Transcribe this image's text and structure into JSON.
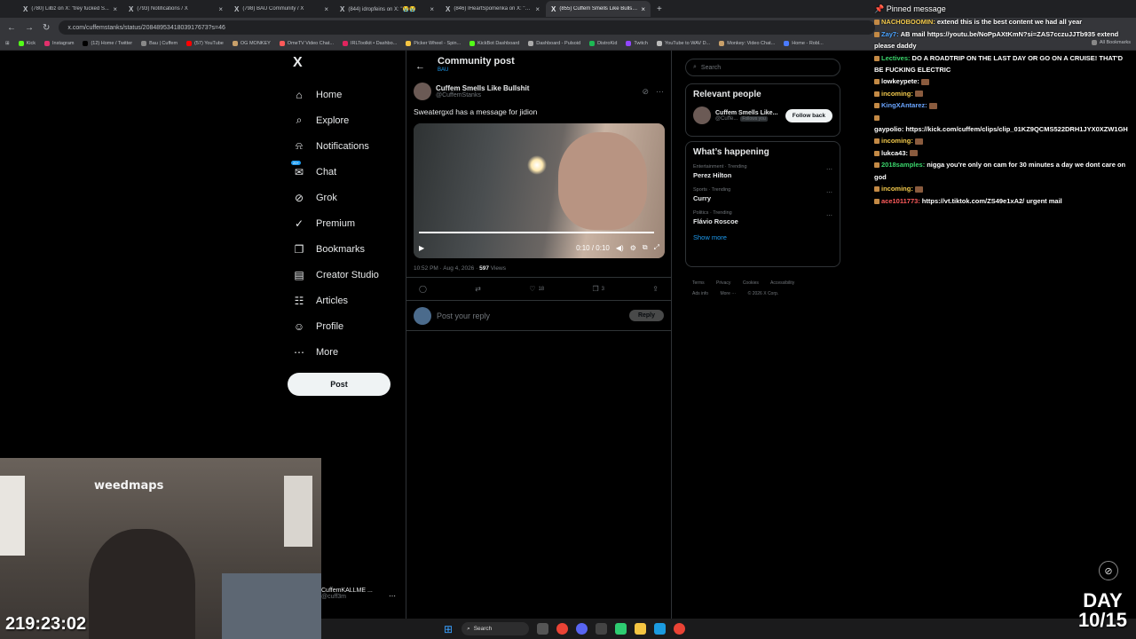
{
  "browser": {
    "tabs": [
      {
        "title": "(780) Lilbz on X: \"trey fucked S..."
      },
      {
        "title": "(793) Notifications / X"
      },
      {
        "title": "(798) BAU Community / X"
      },
      {
        "title": "(844) idropfeins on X: \"😭😭"
      },
      {
        "title": "(846) IHeartSpomenka on X: \"b..."
      },
      {
        "title": "(855) Cuffem Smells Like Bullsh..."
      }
    ],
    "url": "x.com/cuffemstanks/status/2084895341803917673?s=46",
    "bookmarks": [
      "Kick",
      "Instagram",
      "(12) Home / Twitter",
      "Bau | Cuffem",
      "(57) YouTube",
      "OG MONKEY",
      "OmeTV Video Chat...",
      "IRLToolkit • Dashbo...",
      "Picker Wheel - Spin...",
      "KickBot Dashboard",
      "Dashboard - Pulsoid",
      "DistroKid",
      "Twitch",
      "YouTube to WAV D...",
      "Monkey: Video Chat...",
      "Home - Robl..."
    ],
    "all_bookmarks": "All Bookmarks"
  },
  "nav": {
    "logo": "X",
    "items": [
      {
        "label": "Home",
        "icon": "⌂"
      },
      {
        "label": "Explore",
        "icon": "⌕"
      },
      {
        "label": "Notifications",
        "icon": "⍾"
      },
      {
        "label": "Chat",
        "icon": "✉",
        "badge": "20+"
      },
      {
        "label": "Grok",
        "icon": "⊘"
      },
      {
        "label": "Premium",
        "icon": "✓"
      },
      {
        "label": "Bookmarks",
        "icon": "❐"
      },
      {
        "label": "Creator Studio",
        "icon": "▤"
      },
      {
        "label": "Articles",
        "icon": "☷"
      },
      {
        "label": "Profile",
        "icon": "☺"
      },
      {
        "label": "More",
        "icon": "⋯"
      }
    ],
    "post_label": "Post"
  },
  "post": {
    "header_title": "Community post",
    "header_sub": "BAU",
    "author_name": "Cuffem Smells Like Bullshit",
    "author_handle": "@CuffemStanks",
    "text": "Sweatergxd has a message for jidion",
    "video_time": "0:10 / 0:10",
    "meta_time": "10:52 PM · Aug 4, 2026 ·",
    "views_count": "597",
    "views_label": "Views",
    "likes": "18",
    "bookmarks": "3",
    "reply_placeholder": "Post your reply",
    "reply_label": "Reply"
  },
  "sidebar": {
    "search_placeholder": "Search",
    "relevant_title": "Relevant people",
    "relevant_name": "Cuffem Smells Like...",
    "relevant_handle": "@Cuffe...",
    "follows_you": "Follows you",
    "follow_back": "Follow back",
    "happening_title": "What’s happening",
    "trends": [
      {
        "context": "Entertainment · Trending",
        "name": "Perez Hilton"
      },
      {
        "context": "Sports · Trending",
        "name": "Curry"
      },
      {
        "context": "Politics · Trending",
        "name": "Flávio Roscoe"
      }
    ],
    "show_more": "Show more",
    "footer": [
      "Terms",
      "Privacy",
      "Cookies",
      "Accessibility",
      "Ads info",
      "More ···",
      "© 2026 X Corp."
    ]
  },
  "chat": {
    "pinned_label": "Pinned message",
    "lines": [
      {
        "user": "NACHOBOOMIN:",
        "color": "#f2c94c",
        "msg": "extend this is the best content we had all year"
      },
      {
        "user": "Zay7:",
        "color": "#4aa3ff",
        "msg": "AB mail https://youtu.be/NoPpAXtKmN?si=ZAS7cczuJJTb935 extend please daddy"
      },
      {
        "user": "Lectives:",
        "color": "#3ad46b",
        "msg": "DO A ROADTRIP ON THE LAST DAY OR GO ON A CRUISE! THAT'D BE FUCKING ELECTRIC"
      },
      {
        "user": "lowkeypete:",
        "color": "#ffffff",
        "msg": ""
      },
      {
        "user": "incoming:",
        "color": "#f2c94c",
        "msg": ""
      },
      {
        "user": "KingXAntarez:",
        "color": "#6aa5ff",
        "msg": ""
      },
      {
        "user": "gaypolio:",
        "color": "#ffffff",
        "msg": "https://kick.com/cuffem/clips/clip_01KZ9QCMS522DRH1JYX0XZW1GH"
      },
      {
        "user": "incoming:",
        "color": "#f2c94c",
        "msg": ""
      },
      {
        "user": "lukca43:",
        "color": "#ffffff",
        "msg": ""
      },
      {
        "user": "2018samples:",
        "color": "#3ad46b",
        "msg": "nigga you're only on cam for 30 minutes a day we dont care on god"
      },
      {
        "user": "incoming:",
        "color": "#f2c94c",
        "msg": ""
      },
      {
        "user": "ace1011773:",
        "color": "#ff5c5c",
        "msg": "https://vt.tiktok.com/ZS49e1xA2/ urgent mail"
      }
    ]
  },
  "stream": {
    "timer": "219:23:02",
    "day_label": "DAY",
    "day_count": "10/15",
    "cam_sign": "weedmaps",
    "x_account_name": "CuffemKALLME ...",
    "x_account_handle": "@cuff3m"
  },
  "taskbar": {
    "search_label": "Search"
  }
}
